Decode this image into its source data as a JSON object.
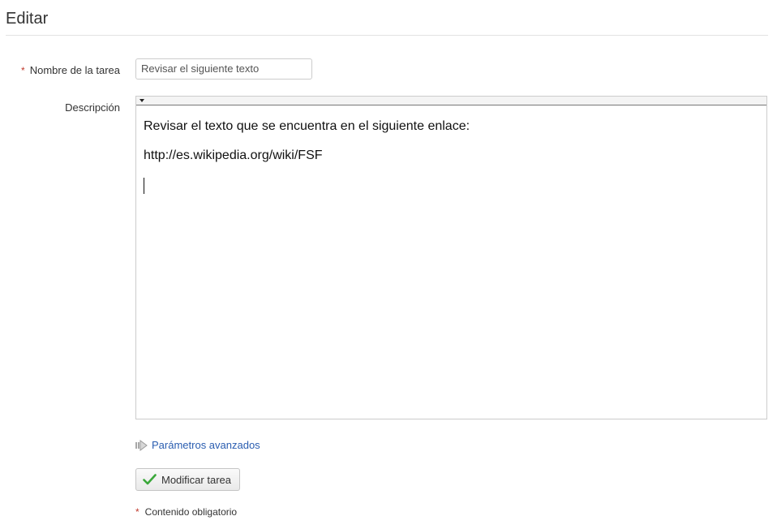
{
  "page": {
    "title": "Editar"
  },
  "form": {
    "task_name": {
      "required_marker": "*",
      "label": "Nombre de la tarea",
      "value": "Revisar el siguiente texto"
    },
    "description": {
      "label": "Descripción",
      "paragraphs": [
        "Revisar el texto que se encuentra en el siguiente enlace:",
        "http://es.wikipedia.org/wiki/FSF"
      ]
    },
    "advanced_link": {
      "label": "Parámetros avanzados",
      "icon": "arrow-right-icon"
    },
    "submit_button": {
      "label": "Modificar tarea",
      "icon": "checkmark-icon"
    },
    "required_note": {
      "marker": "*",
      "text": "Contenido obligatorio"
    }
  },
  "colors": {
    "required": "#c0392b",
    "link": "#2a5db0",
    "check": "#3aa83a"
  }
}
